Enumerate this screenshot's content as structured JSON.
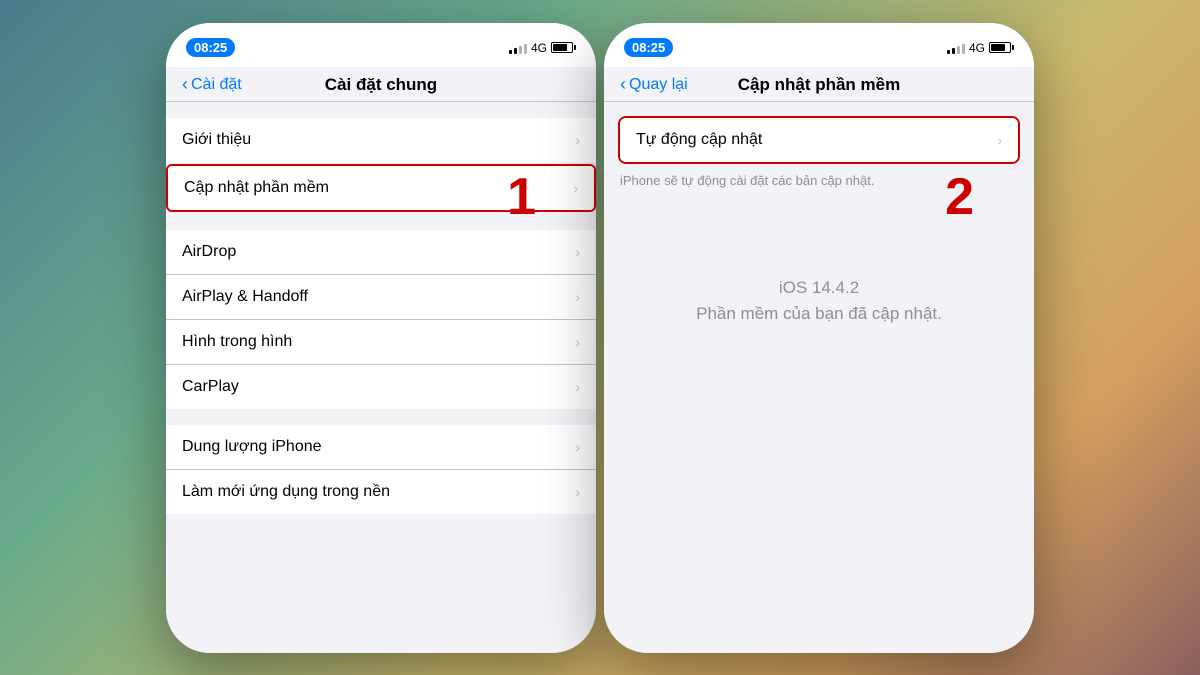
{
  "left_phone": {
    "status_time": "08:25",
    "network": "4G",
    "step_number": "1",
    "nav_back_text": "Cài đặt",
    "nav_title": "Cài đặt chung",
    "rows_group1": [
      {
        "label": "Giới thiệu",
        "highlighted": false
      }
    ],
    "rows_group2": [
      {
        "label": "Cập nhật phần mềm",
        "highlighted": true
      }
    ],
    "rows_group3": [
      {
        "label": "AirDrop",
        "highlighted": false
      },
      {
        "label": "AirPlay & Handoff",
        "highlighted": false
      },
      {
        "label": "Hình trong hình",
        "highlighted": false
      },
      {
        "label": "CarPlay",
        "highlighted": false
      }
    ],
    "rows_group4": [
      {
        "label": "Dung lượng iPhone",
        "highlighted": false
      },
      {
        "label": "Làm mới ứng dụng trong nền",
        "highlighted": false
      }
    ]
  },
  "right_phone": {
    "status_time": "08:25",
    "network": "4G",
    "step_number": "2",
    "nav_back_text": "Quay lại",
    "nav_title": "Cập nhật phần mềm",
    "auto_update_label": "Tự động cập nhật",
    "description": "iPhone sẽ tự động cài đặt các bản cập nhật.",
    "version": "iOS 14.4.2",
    "update_status": "Phần mềm của bạn đã cập nhật."
  }
}
